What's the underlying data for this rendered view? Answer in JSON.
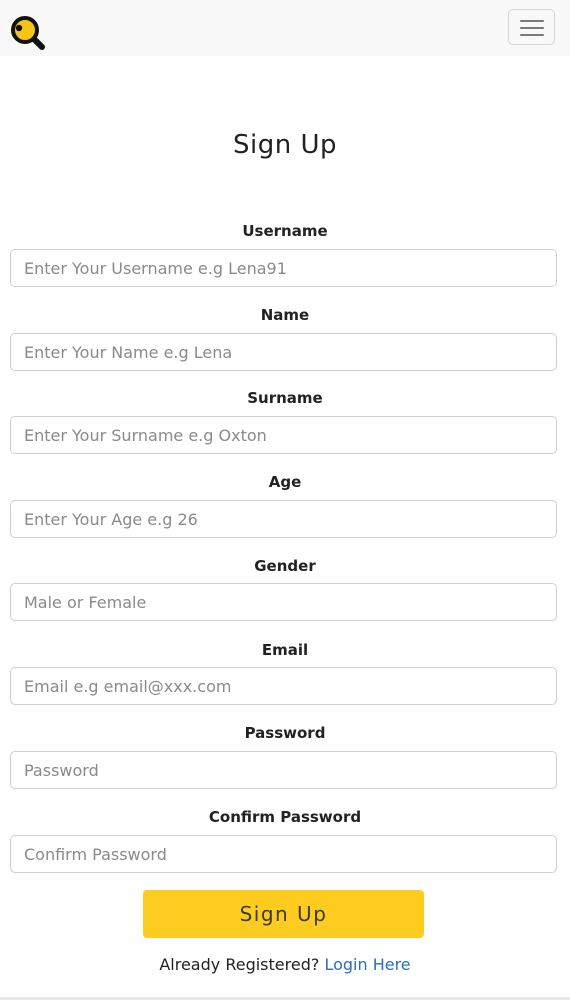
{
  "header": {
    "logo_icon": "magnifier-icon",
    "menu_icon": "hamburger-menu-icon"
  },
  "page": {
    "title": "Sign Up"
  },
  "form": {
    "fields": [
      {
        "label": "Username",
        "placeholder": "Enter Your Username e.g Lena91",
        "value": ""
      },
      {
        "label": "Name",
        "placeholder": "Enter Your Name e.g Lena",
        "value": ""
      },
      {
        "label": "Surname",
        "placeholder": "Enter Your Surname e.g Oxton",
        "value": ""
      },
      {
        "label": "Age",
        "placeholder": "Enter Your Age e.g 26",
        "value": ""
      },
      {
        "label": "Gender",
        "placeholder": "Male or Female",
        "value": ""
      },
      {
        "label": "Email",
        "placeholder": "Email e.g email@xxx.com",
        "value": ""
      },
      {
        "label": "Password",
        "placeholder": "Password",
        "value": ""
      },
      {
        "label": "Confirm Password",
        "placeholder": "Confirm Password",
        "value": ""
      }
    ],
    "submit_label": "Sign Up"
  },
  "footer": {
    "prompt": "Already Registered?",
    "login_link": "Login Here"
  },
  "colors": {
    "accent": "#fecb1f",
    "link": "#2b6fb6",
    "navbar_bg": "#f8f8f8"
  }
}
